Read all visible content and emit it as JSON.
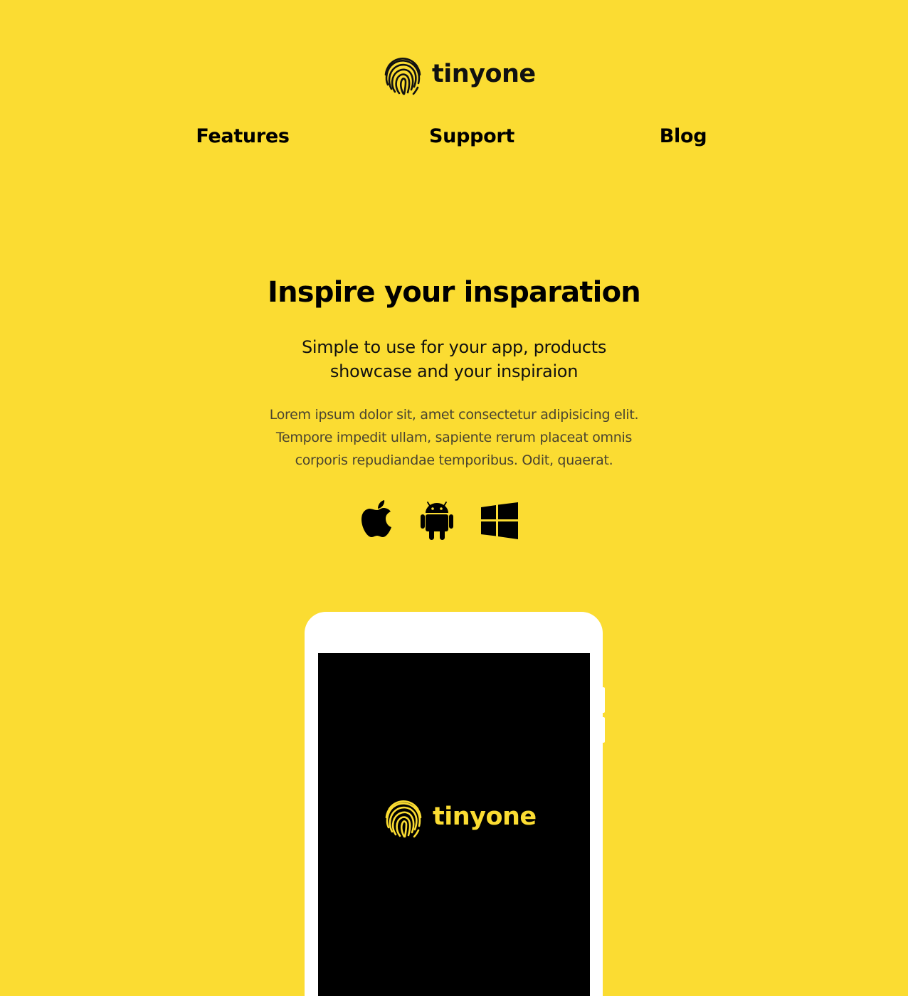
{
  "brand": {
    "name": "tinyone",
    "icon": "fingerprint-icon",
    "colors": {
      "background": "#fbdc32",
      "text": "#000000",
      "muted_text": "#4a4430",
      "phone_frame": "#ffffff",
      "phone_screen": "#000000"
    }
  },
  "nav": {
    "items": [
      {
        "label": "Features"
      },
      {
        "label": "Support"
      },
      {
        "label": "Blog"
      }
    ]
  },
  "hero": {
    "title": "Inspire your insparation",
    "subtitle_line1": "Simple to use for your app, products",
    "subtitle_line2": "showcase and your inspiraion",
    "body_line1": "Lorem ipsum dolor sit, amet consectetur adipisicing elit.",
    "body_line2": "Tempore impedit ullam, sapiente rerum placeat omnis",
    "body_line3": "corporis repudiandae temporibus. Odit, quaerat."
  },
  "platforms": [
    {
      "icon": "apple-icon"
    },
    {
      "icon": "android-icon"
    },
    {
      "icon": "windows-icon"
    }
  ],
  "phone": {
    "screen_logo_text": "tinyone"
  }
}
